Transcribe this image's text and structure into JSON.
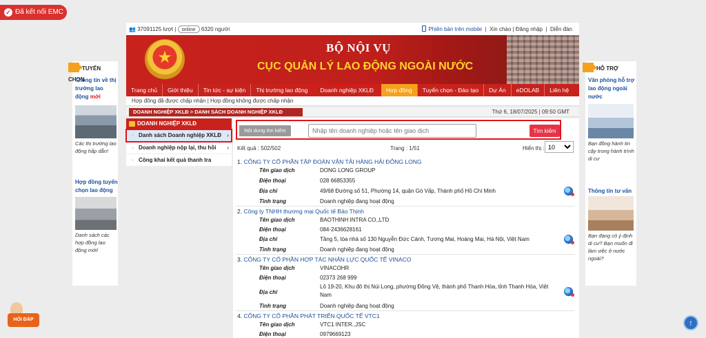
{
  "emc": {
    "label": "Đã kết nối EMC"
  },
  "topbar": {
    "visits": "37091125 lượt",
    "online_label": "online",
    "online_count": "6320 người",
    "mobile": "Phiên bản trên mobile",
    "greeting": "Xin chào",
    "login": "Đăng nhập",
    "forum": "Diễn đàn"
  },
  "banner": {
    "ministry": "BỘ NỘI VỤ",
    "department": "CỤC QUẢN LÝ LAO ĐỘNG NGOÀI NƯỚC"
  },
  "nav": [
    {
      "label": "Trang chủ"
    },
    {
      "label": "Giới thiệu"
    },
    {
      "label": "Tin tức - sự kiện"
    },
    {
      "label": "Thị trường lao động"
    },
    {
      "label": "Doanh nghiệp XKLĐ"
    },
    {
      "label": "Hợp đồng"
    },
    {
      "label": "Tuyển chọn - Đào tạo"
    },
    {
      "label": "Dự Án"
    },
    {
      "label": "eDOLAB"
    },
    {
      "label": "Liên hệ"
    }
  ],
  "subnav": {
    "accepted": "Hợp đồng đã được chấp nhận",
    "separator": "|",
    "rejected": "Hợp đồng không được chấp nhận"
  },
  "breadcrumb": "DOANH NGHIỆP XKLĐ > DANH SÁCH DOANH NGHIỆP XKLĐ",
  "date": "Thứ 6, 18/07/2025 | 09:50 GMT",
  "submenu": {
    "title": "DOANH NGHIỆP XKLĐ",
    "items": [
      {
        "label": "Danh sách Doanh nghiệp XKLĐ"
      },
      {
        "label": "Doanh nghiệp nộp lại, thu hồi"
      },
      {
        "label": "Công khai kết quả thanh tra"
      }
    ]
  },
  "search": {
    "label": "Nội dung tìm kiếm",
    "placeholder": "Nhập tên doanh nghiệp hoặc tên giao dịch",
    "button": "Tìm kiếm"
  },
  "results": {
    "count": "Kết quả : 502/502",
    "page": "Trang : 1/51",
    "show_label": "Hiển thị :",
    "show_value": "10"
  },
  "labels": {
    "trade_name": "Tên giao dịch",
    "phone": "Điện thoại",
    "address": "Địa chỉ",
    "status": "Tình trạng"
  },
  "companies": [
    {
      "num": "1.",
      "name": "CÔNG TY CỔ PHẦN TẬP ĐOÀN VẬN TẢI HÀNG HẢI ĐÔNG LONG",
      "trade_name": "DONG LONG GROUP",
      "phone": "028 66853355",
      "address": "49/68 Đường số 51, Phường 14, quận Gò Vấp, Thành phố Hồ Chí Minh",
      "status": "Doanh nghiệp đang hoạt động"
    },
    {
      "num": "2.",
      "name": "Công ty TNHH thương mại Quốc tế Bảo Thịnh",
      "trade_name": "BAOTHINH INTRA CO.,LTD",
      "phone": "084-2436628161",
      "address": "Tầng 5, tòa nhà số 130 Nguyễn Đức Cảnh, Tương Mai, Hoàng Mai, Hà Nội, Việt Nam",
      "status": "Doanh nghiệp đang hoạt động"
    },
    {
      "num": "3.",
      "name": "CÔNG TY CỔ PHẦN HỢP TÁC NHÂN LỰC QUỐC TẾ VINACO",
      "trade_name": "VINACOHR",
      "phone": "02373 268 999",
      "address": "Lô 19-20, Khu đô thị Núi Long, phường Đông Vệ, thành phố Thanh Hóa, tỉnh Thanh Hóa, Việt Nam",
      "status": "Doanh nghiệp đang hoạt động"
    },
    {
      "num": "4.",
      "name": "CÔNG TY CỔ PHẦN PHÁT TRIỂN QUỐC TẾ VTC1",
      "trade_name": "VTC1 INTER.,JSC",
      "phone": "0979669123"
    }
  ],
  "left_panel": {
    "title": "TUYỂN CHỌN",
    "link1_a": "Thông tin về thị trường lao động",
    "link1_new": "mới",
    "caption1": "Các thị trường lao động hấp dẫn!",
    "link2": "Hợp đồng tuyển chọn lao động",
    "caption2": "Danh sách các hợp đồng lao động mới!"
  },
  "right_panel": {
    "title": "HỖ TRỢ",
    "link1": "Văn phòng hỗ trợ lao động ngoài nước",
    "caption1": "Bạn đồng hành tin cậy trong hành trình di cư",
    "link2": "Thông tin tư vấn",
    "caption2": "Bạn đang có ý định di cư? Bạn muốn đi làm việc ở nước ngoài?"
  },
  "hoidap": {
    "label": "HỎI ĐÁP"
  }
}
